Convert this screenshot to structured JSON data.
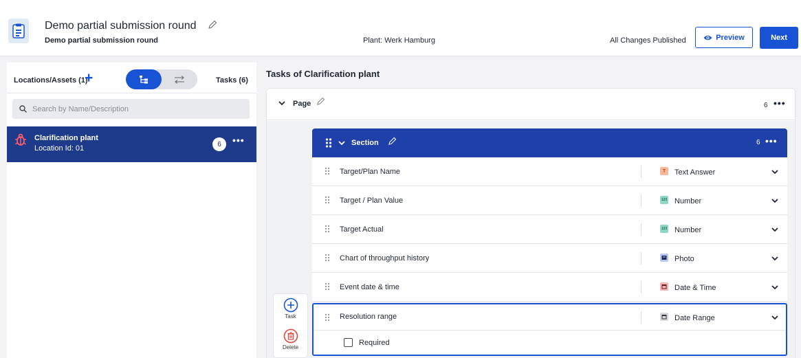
{
  "header": {
    "title": "Demo partial submission round",
    "subtitle": "Demo partial submission round",
    "plant_label": "Plant:",
    "plant_value": "Werk Hamburg",
    "status": "All Changes Published",
    "preview_label": "Preview",
    "next_label": "Next"
  },
  "left": {
    "locations_title": "Locations/Assets (1)",
    "tasks_count": "Tasks (6)",
    "search": {
      "placeholder": "Search by Name/Description",
      "value": ""
    },
    "locations": [
      {
        "name": "Clarification plant",
        "location_id": "Location Id: 01",
        "badge": "6"
      }
    ]
  },
  "main": {
    "tasks_title": "Tasks of Clarification plant",
    "page": {
      "label": "Page",
      "count": "6"
    },
    "section": {
      "label": "Section",
      "count": "6"
    },
    "questions": [
      {
        "text": "Target/Plan Name",
        "type": "Text Answer",
        "type_icon": "T",
        "type_color": "#f7b79b"
      },
      {
        "text": "Target / Plan Value",
        "type": "Number",
        "type_icon": "123",
        "type_color": "#8fd6c5"
      },
      {
        "text": "Target Actual",
        "type": "Number",
        "type_icon": "123",
        "type_color": "#8fd6c5"
      },
      {
        "text": "Chart of throughput history",
        "type": "Photo",
        "type_icon": "photo-icon",
        "type_color": "#b8c8f0"
      },
      {
        "text": "Event date & time",
        "type": "Date & Time",
        "type_icon": "calendar-icon",
        "type_color": "#f5b3b3"
      },
      {
        "text": "Resolution range",
        "type": "Date Range",
        "type_icon": "calendar-icon",
        "type_color": "#d6d8dc"
      }
    ],
    "required_label": "Required",
    "tools": {
      "task_label": "Task",
      "delete_label": "Delete"
    }
  },
  "colors": {
    "primary": "#1853d6",
    "section_blue": "#1e40a8",
    "selected_location": "#1e3a8a",
    "delete_red": "#e0473a"
  }
}
